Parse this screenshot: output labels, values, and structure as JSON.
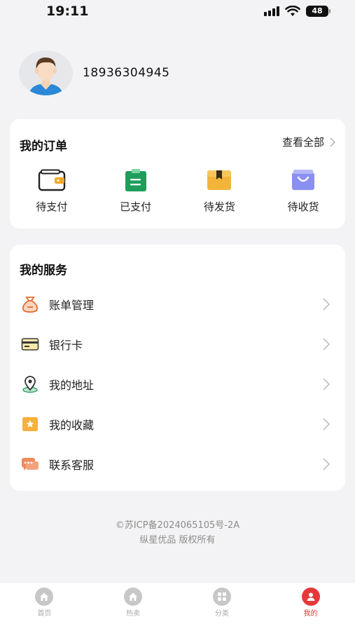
{
  "status_bar": {
    "time": "19:11",
    "battery": "48"
  },
  "profile": {
    "phone": "18936304945"
  },
  "orders": {
    "title": "我的订单",
    "view_all": "查看全部",
    "items": [
      {
        "label": "待支付",
        "icon": "wallet-icon"
      },
      {
        "label": "已支付",
        "icon": "clipboard-icon"
      },
      {
        "label": "待发货",
        "icon": "package-icon"
      },
      {
        "label": "待收货",
        "icon": "shopping-bag-icon"
      }
    ]
  },
  "services": {
    "title": "我的服务",
    "items": [
      {
        "label": "账单管理",
        "icon": "money-bag-icon"
      },
      {
        "label": "银行卡",
        "icon": "bank-card-icon"
      },
      {
        "label": "我的地址",
        "icon": "location-pin-icon"
      },
      {
        "label": "我的收藏",
        "icon": "star-folder-icon"
      },
      {
        "label": "联系客服",
        "icon": "chat-bubbles-icon"
      }
    ]
  },
  "footer": {
    "icp": "©苏ICP备2024065105号-2A",
    "copyright": "纵星优品 版权所有"
  },
  "tabbar": {
    "items": [
      {
        "label": "首页",
        "icon": "home-icon",
        "active": false
      },
      {
        "label": "热卖",
        "icon": "home-icon",
        "active": false
      },
      {
        "label": "分类",
        "icon": "grid-icon",
        "active": false
      },
      {
        "label": "我的",
        "icon": "user-icon",
        "active": true
      }
    ]
  },
  "colors": {
    "accent": "#e5383b",
    "background": "#f3f3f5",
    "card": "#ffffff",
    "order_paid": "#1f9e5b",
    "order_ship": "#f2b53a",
    "order_receive": "#7b7ff0"
  }
}
